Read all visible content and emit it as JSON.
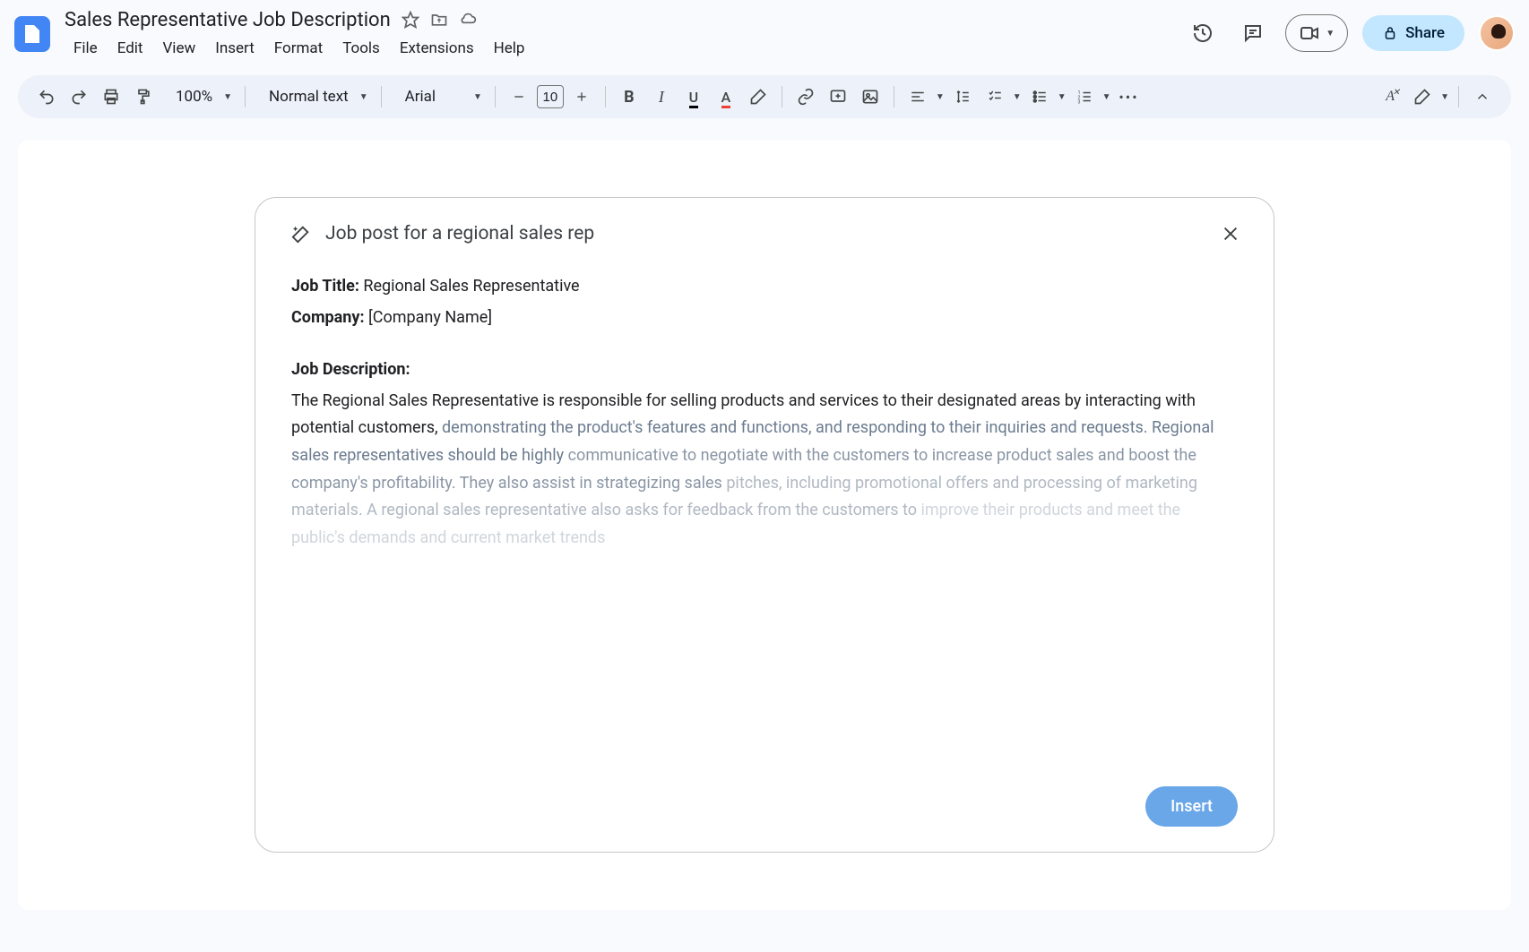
{
  "header": {
    "doc_title": "Sales Representative Job Description",
    "menus": [
      "File",
      "Edit",
      "View",
      "Insert",
      "Format",
      "Tools",
      "Extensions",
      "Help"
    ],
    "share_label": "Share"
  },
  "toolbar": {
    "zoom": "100%",
    "style": "Normal text",
    "font": "Arial",
    "font_size": "10"
  },
  "ai_card": {
    "prompt": "Job post for a regional sales rep",
    "job_title_label": "Job Title:",
    "job_title_value": " Regional Sales Representative",
    "company_label": "Company:",
    "company_value": " [Company Name]",
    "job_desc_label": "Job Description:",
    "desc_line1": "The Regional Sales Representative is responsible for selling products and services to their designated areas by interacting with potential customers,",
    "desc_line2": "demonstrating the product's features and functions, and responding to their inquiries and requests. Regional sales representatives should be highly",
    "desc_line3": "communicative to negotiate with the customers to increase product sales and boost the company's profitability. They also assist in strategizing sales",
    "desc_line4": "pitches, including promotional offers and processing of marketing materials. A regional sales representative also asks for feedback from the customers to",
    "desc_line5": "improve their products and meet the public's demands and current market trends",
    "insert_label": "Insert"
  }
}
